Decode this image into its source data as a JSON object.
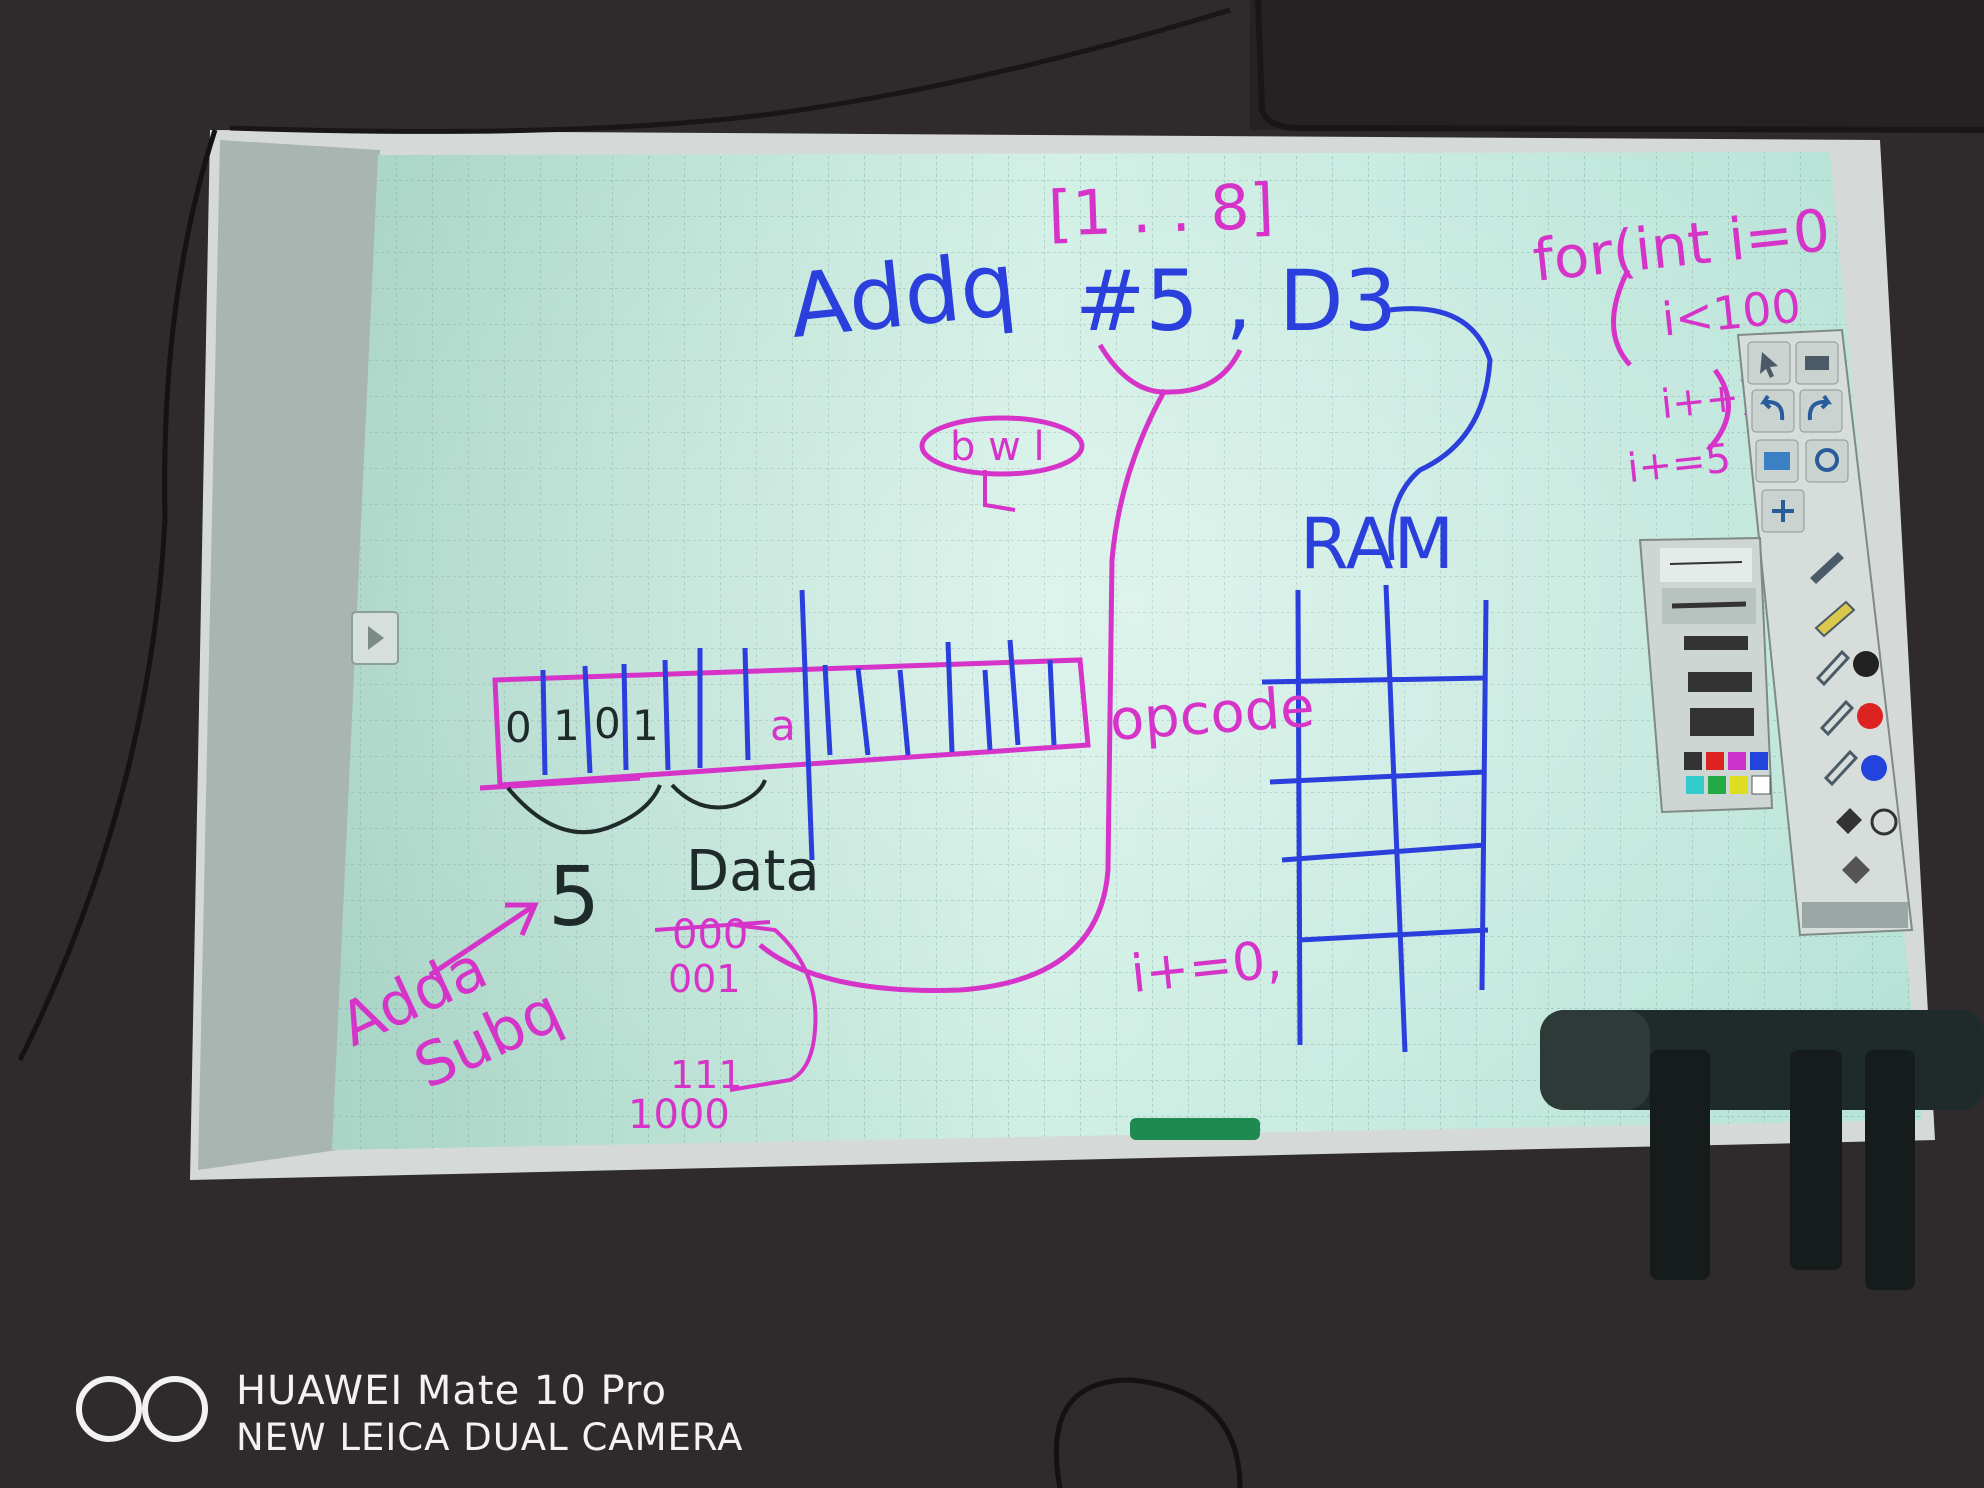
{
  "board": {
    "range_label": "[1 . . 8]",
    "instruction": {
      "mnemonic": "Addq",
      "operands": "#5 , D3",
      "ring_sub": "b w l"
    },
    "for_loop": {
      "line1": "for(int i=0",
      "line2": "i<100",
      "line3": "i++)",
      "line4": "i+=5"
    },
    "ram_label": "RAM",
    "opcode_label": "opcode",
    "register_bits": [
      "0",
      "1",
      "0",
      "1",
      "",
      "",
      "a"
    ],
    "data_label": "Data",
    "five_label": "5",
    "ops": {
      "line1": "Adda",
      "line2": "Subq"
    },
    "binary": {
      "struck": "000",
      "row2": "001",
      "row3": "111",
      "row4": "1000"
    },
    "increment": "i+=0,"
  },
  "toolbar": {
    "tools": [
      "pointer-icon",
      "print-icon",
      "undo-icon",
      "redo-icon",
      "screen-icon",
      "zoom-icon",
      "move-icon"
    ],
    "pens": [
      "pen-icon",
      "highlighter-icon",
      "pen-icon",
      "pen-icon",
      "pen-icon",
      "eraser-icon",
      "clear-icon"
    ],
    "ink_colors": [
      "#222222",
      "#dd2222",
      "#2244dd"
    ],
    "palette": [
      "#333333",
      "#dd2222",
      "#cc33cc",
      "#2244dd",
      "#33cccc",
      "#22aa44",
      "#dddd22",
      "#ffffff"
    ]
  },
  "colors": {
    "magenta_ink": "#d633c9",
    "blue_ink": "#2b3fdc",
    "dark_ink": "#1f2a2a",
    "board": "#bfe6da"
  },
  "watermark": {
    "line1": "HUAWEI Mate 10 Pro",
    "line2": "NEW LEICA DUAL CAMERA"
  }
}
